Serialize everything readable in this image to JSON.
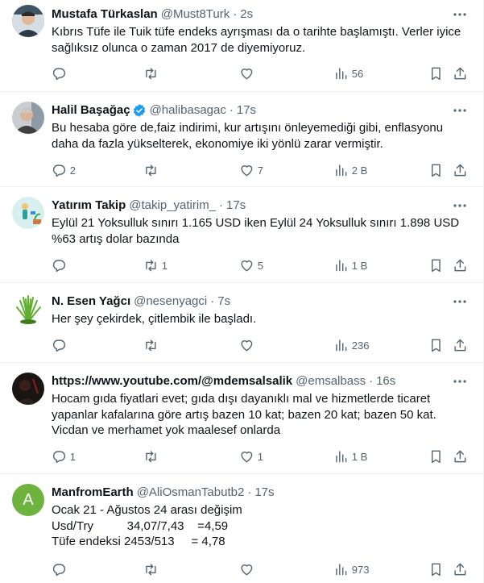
{
  "tweets": [
    {
      "name": "Mustafa Türkaslan",
      "handle": "@Must8Turk",
      "dot": "·",
      "time": "2s",
      "text": "Kıbrıs Tüfe ile Tuik tüfe endeks ayrışması da o tarihte başlamıştı. Verler iyice\nsağlıksız olunca o zaman 2017 de diyemiyoruz.",
      "replies": "",
      "retweets": "",
      "likes": "",
      "views": "56",
      "verified": false,
      "avatar_icon": "person-photo-icon"
    },
    {
      "name": "Halil Başağaç",
      "handle": "@halibasagac",
      "dot": "·",
      "time": "17s",
      "text": "Bu hesaba göre de,faiz indirimi, kur artışını önleyemediği gibi, enflasyonu\ndaha da fazla yükselterek, ekonomiye iki yönlü zarar vermiştir.",
      "replies": "2",
      "retweets": "",
      "likes": "7",
      "views": "2 B",
      "verified": true,
      "avatar_icon": "person-photo-icon"
    },
    {
      "name": "Yatırım Takip",
      "handle": "@takip_yatirim_",
      "dot": "·",
      "time": "17s",
      "text": "Eylül 21 Yoksulluk sınırı 1.165 USD iken Eylül 24 Yoksulluk sınırı 1.898 USD\n%63 artış dolar bazında",
      "replies": "",
      "retweets": "1",
      "likes": "5",
      "views": "1 B",
      "verified": false,
      "avatar_icon": "plant-watering-icon"
    },
    {
      "name": "N. Esen Yağcı",
      "handle": "@nesenyagci",
      "dot": "·",
      "time": "7s",
      "text": "Her şey çekirdek, çitlembik ile başladı.",
      "replies": "",
      "retweets": "",
      "likes": "",
      "views": "236",
      "verified": false,
      "avatar_icon": "grass-icon"
    },
    {
      "name": "https://www.youtube.com/@mdemsalsalik",
      "handle": "@emsalbass",
      "dot": "·",
      "time": "16s",
      "text": "Hocam gıda fiyatlari evet; gıda dışı dayanıklı mal ve hizmetlerde ticaret\nyapanlar kafalarına göre artış bazen 10 kat; bazen 20 kat; bazen 50 kat.\nVicdan ve merhamet yok maalesef onlarda",
      "replies": "1",
      "retweets": "",
      "likes": "1",
      "views": "1 B",
      "verified": false,
      "avatar_icon": "dark-photo-icon"
    },
    {
      "name": "ManfromEarth",
      "handle": "@AliOsmanTabutb2",
      "dot": "·",
      "time": "17s",
      "text": "Ocak 21 - Ağustos 24 arası değişim\nUsd/Try          34,07/7,43    =4,59\nTüfe endeksi 2453/513     = 4,78",
      "replies": "",
      "retweets": "",
      "likes": "",
      "views": "973",
      "verified": false,
      "avatar_letter": "A",
      "avatar_icon": "letter-avatar-icon"
    }
  ],
  "colors": {
    "text": "#0f1419",
    "secondary": "#536471",
    "border": "#eff3f4",
    "verified": "#1d9bf0",
    "letter_avatar": "#6fb33f"
  }
}
